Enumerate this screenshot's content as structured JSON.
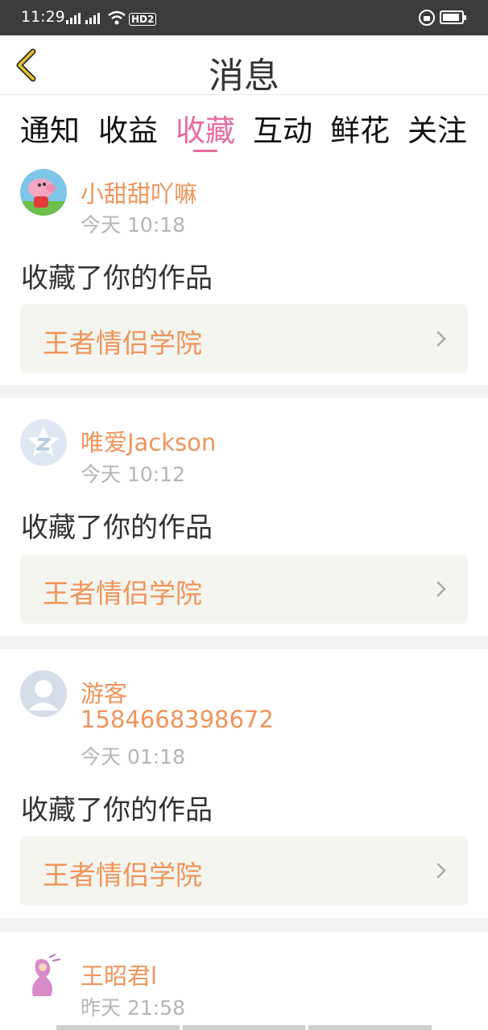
{
  "status_bar": {
    "time": "11:29",
    "signal_1_label": "2G",
    "signal_2_label": "4G",
    "hd_label": "HD2"
  },
  "header": {
    "title": "消息",
    "back_icon": "chevron-left-icon"
  },
  "tabs": [
    {
      "label": "通知",
      "active": false
    },
    {
      "label": "收益",
      "active": false
    },
    {
      "label": "收藏",
      "active": true
    },
    {
      "label": "互动",
      "active": false
    },
    {
      "label": "鲜花",
      "active": false
    },
    {
      "label": "关注",
      "active": false
    }
  ],
  "messages": [
    {
      "username": "小甜甜吖嘛",
      "time": "今天 10:18",
      "action": "收藏了你的作品",
      "work_title": "王者情侣学院"
    },
    {
      "username": "唯爱Jackson",
      "time": "今天 10:12",
      "action": "收藏了你的作品",
      "work_title": "王者情侣学院"
    },
    {
      "username_line1": "游客",
      "username_line2": "1584668398672",
      "time": "今天 01:18",
      "action": "收藏了你的作品",
      "work_title": "王者情侣学院"
    },
    {
      "username": "王昭君l",
      "time": "昨天 21:58"
    }
  ],
  "colors": {
    "accent_pink": "#e86b9e",
    "username_orange": "#f0945a",
    "back_arrow_yellow": "#e8c530",
    "work_box_bg": "#f5f5ef"
  }
}
